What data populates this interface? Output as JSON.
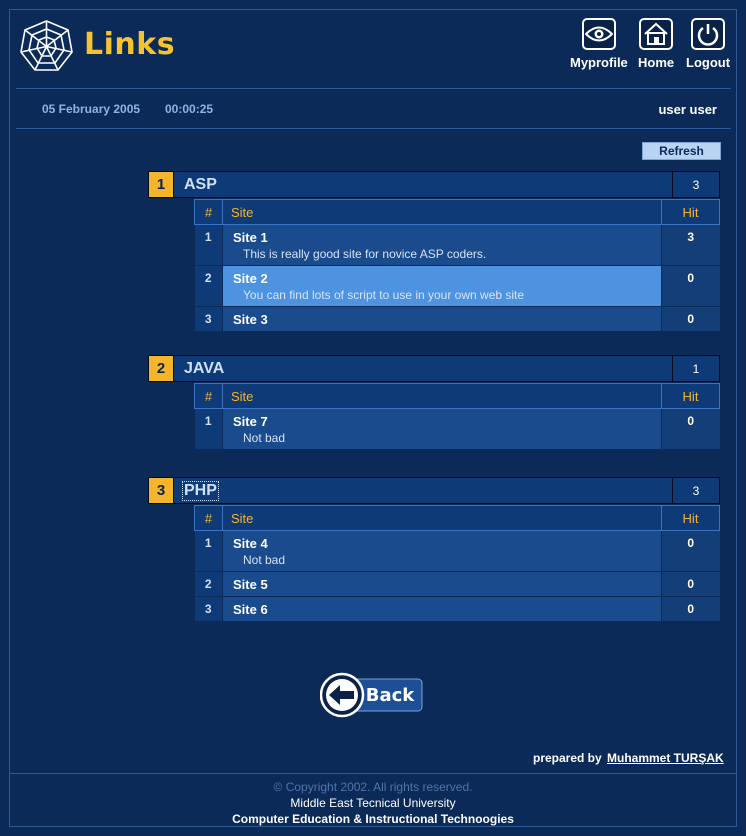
{
  "header": {
    "title": "Links",
    "logo_icon": "spider-web-icon",
    "nav": [
      {
        "label": "Myprofile",
        "icon": "eye-icon"
      },
      {
        "label": "Home",
        "icon": "house-icon"
      },
      {
        "label": "Logout",
        "icon": "power-icon"
      }
    ]
  },
  "infobar": {
    "date": "05 February 2005",
    "time": "00:00:25",
    "user": "user user"
  },
  "refresh_label": "Refresh",
  "table_headers": {
    "num": "#",
    "site": "Site",
    "hit": "Hit"
  },
  "categories": [
    {
      "index": "1",
      "name": "ASP",
      "count": "3",
      "links": [
        {
          "num": "1",
          "site": "Site 1",
          "desc": "This is really good site for novice ASP coders.",
          "hit": "3"
        },
        {
          "num": "2",
          "site": "Site 2",
          "desc": "You can find lots of script to use in your own web site",
          "hit": "0",
          "highlighted": true
        },
        {
          "num": "3",
          "site": "Site 3",
          "desc": "",
          "hit": "0"
        }
      ]
    },
    {
      "index": "2",
      "name": "JAVA",
      "count": "1",
      "links": [
        {
          "num": "1",
          "site": "Site 7",
          "desc": "Not bad",
          "hit": "0"
        }
      ]
    },
    {
      "index": "3",
      "name": "PHP",
      "count": "3",
      "links": [
        {
          "num": "1",
          "site": "Site 4",
          "desc": "Not bad",
          "hit": "0"
        },
        {
          "num": "2",
          "site": "Site 5",
          "desc": "",
          "hit": "0"
        },
        {
          "num": "3",
          "site": "Site 6",
          "desc": "",
          "hit": "0"
        }
      ]
    }
  ],
  "back_label": "Back",
  "footer": {
    "prepared_by": "prepared by",
    "author": "Muhammet TURŞAK",
    "copyright": "© Copyright 2002. All rights reserved.",
    "university": "Middle East Tecnical University",
    "department": "Computer Education & Instructional Technoogies"
  },
  "colors": {
    "background": "#0c2a57",
    "accent": "#f5b52a",
    "highlight_row": "#4d93e0"
  }
}
